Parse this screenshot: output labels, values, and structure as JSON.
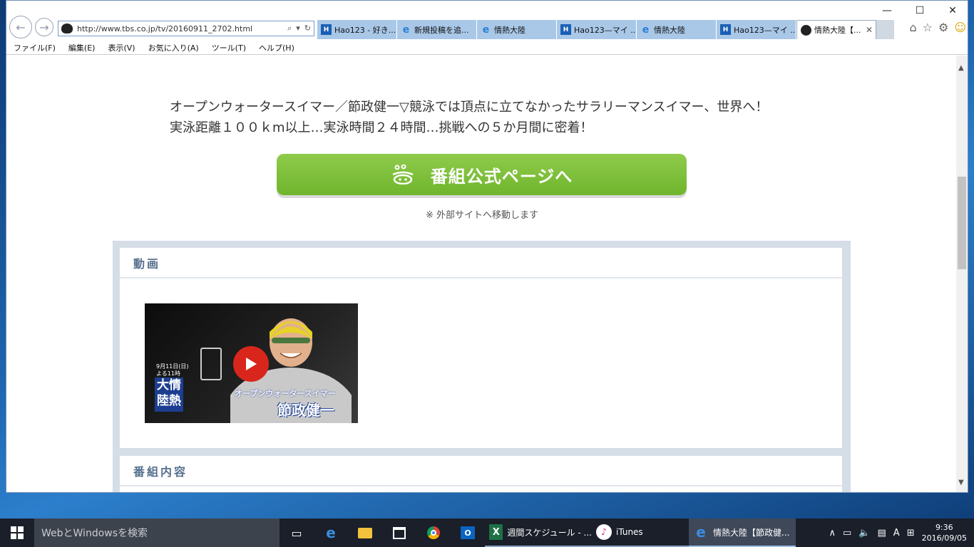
{
  "window": {
    "caption": {
      "minimize": "—",
      "maximize": "☐",
      "close": "✕"
    }
  },
  "address": {
    "url": "http://www.tbs.co.jp/tv/20160911_2702.html"
  },
  "tabs": [
    {
      "label": "Hao123 - 好き...",
      "icon": "hao123-icon"
    },
    {
      "label": "新規投稿を追...",
      "icon": "ie-icon"
    },
    {
      "label": "情熱大陸",
      "icon": "ie-icon"
    },
    {
      "label": "Hao123—マイ ...",
      "icon": "hao123-icon"
    },
    {
      "label": "情熱大陸",
      "icon": "ie-icon"
    },
    {
      "label": "Hao123—マイ ...",
      "icon": "hao123-icon"
    },
    {
      "label": "情熱大陸【...",
      "icon": "tbs-bear-icon",
      "active": true
    }
  ],
  "menu": [
    "ファイル(F)",
    "編集(E)",
    "表示(V)",
    "お気に入り(A)",
    "ツール(T)",
    "ヘルプ(H)"
  ],
  "page": {
    "desc_line1": "オープンウォータースイマー／節政健一▽競泳では頂点に立てなかったサラリーマンスイマー、世界へ！",
    "desc_line2": "実泳距離１００ｋm以上…実泳時間２４時間…挑戦への５か月間に密着！",
    "official_button": "番組公式ページへ",
    "external_note": "※ 外部サイトへ移動します",
    "video_section_title": "動画",
    "video": {
      "date_line1": "9月11日(日)",
      "date_line2": "よる11時",
      "logo_line1": "大情",
      "logo_line2": "陸熱",
      "caption_small": "オープンウォータースイマー",
      "caption_large": "節政健一"
    },
    "program_section_title": "番組内容"
  },
  "taskbar": {
    "search_placeholder": "WebとWindowsを検索",
    "excel_label": "週間スケジュール - ...",
    "itunes_label": "iTunes",
    "ie_label": "情熱大陸【節政健...",
    "ime": "A",
    "time": "9:36",
    "date": "2016/09/05"
  },
  "colors": {
    "button_green": "#7cbf3a",
    "section_title": "#56708e",
    "section_bg": "#d5dde7",
    "tab_bg": "#a9c8e8",
    "taskbar_bg": "#1a1f2a"
  }
}
